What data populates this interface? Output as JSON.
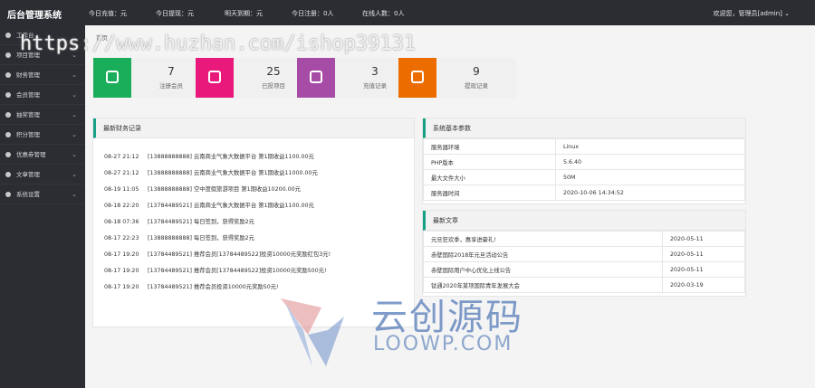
{
  "header": {
    "brand": "后台管理系统",
    "stats": [
      {
        "label": "今日充值：元"
      },
      {
        "label": "今日提现：元"
      },
      {
        "label": "明天到期：元"
      },
      {
        "label": "今日注册：0人"
      },
      {
        "label": "在线人数：0人"
      }
    ],
    "welcome": "欢迎您，管理员[admin]"
  },
  "sidebar": {
    "items": [
      {
        "label": "工作台"
      },
      {
        "label": "项目管理"
      },
      {
        "label": "财务管理"
      },
      {
        "label": "会员管理"
      },
      {
        "label": "抽奖管理"
      },
      {
        "label": "积分管理"
      },
      {
        "label": "优惠券管理"
      },
      {
        "label": "文章管理"
      },
      {
        "label": "系统设置"
      }
    ]
  },
  "breadcrumb": "首页",
  "cards": [
    {
      "value": "7",
      "label": "注册会员",
      "color": "#1aad5a"
    },
    {
      "value": "25",
      "label": "已投项目",
      "color": "#e8197b"
    },
    {
      "value": "3",
      "label": "充值记录",
      "color": "#a64ca6"
    },
    {
      "value": "9",
      "label": "提现记录",
      "color": "#ec6c00"
    }
  ],
  "finance_log": {
    "title": "最新财务记录",
    "rows": [
      {
        "time": "08-27 21:12",
        "text": "[13888888888] 云南商业气象大数据平台 第1期收益1100.00元"
      },
      {
        "time": "08-27 21:12",
        "text": "[13888888888] 云南商业气象大数据平台 第1期收益11000.00元"
      },
      {
        "time": "08-19 11:05",
        "text": "[13888888888] 空中度假旅游项目 第1期收益10200.00元"
      },
      {
        "time": "08-18 22:20",
        "text": "[13784489521] 云南商业气象大数据平台 第1期收益1100.00元"
      },
      {
        "time": "08-18 07:36",
        "text": "[13784489521] 每日签到，获得奖励2元"
      },
      {
        "time": "08-17 22:23",
        "text": "[13888888888] 每日签到，获得奖励2元"
      },
      {
        "time": "08-17 19:20",
        "text": "[13784489521] 推荐会员[13784489522]投资10000元奖励红包3元!"
      },
      {
        "time": "08-17 19:20",
        "text": "[13784489521] 推荐会员[13784489522]投资10000元奖励500元!"
      },
      {
        "time": "08-17 19:20",
        "text": "[13784489521] 推荐会员投资10000元奖励50元!"
      }
    ]
  },
  "system_params": {
    "title": "系统基本参数",
    "rows": [
      {
        "key": "服务器环境",
        "value": "Linux"
      },
      {
        "key": "PHP版本",
        "value": "5.6.40"
      },
      {
        "key": "最大文件大小",
        "value": "50M"
      },
      {
        "key": "服务器时间",
        "value": "2020-10-06 14:34:52"
      }
    ]
  },
  "articles": {
    "title": "最新文章",
    "rows": [
      {
        "title": "元旦狂欢季，惠享进豪礼!",
        "date": "2020-05-11"
      },
      {
        "title": "赤壁国际2018年元旦活动公告",
        "date": "2020-05-11"
      },
      {
        "title": "赤壁国际用户中心优化上线公告",
        "date": "2020-05-11"
      },
      {
        "title": "钛通2020年某项国际青年发展大会",
        "date": "2020-03-19"
      }
    ]
  },
  "watermark": {
    "url": "https://www.huzhan.com/ishop39131",
    "brand_cn": "云创源码",
    "brand_en": "LOOWP.COM"
  }
}
